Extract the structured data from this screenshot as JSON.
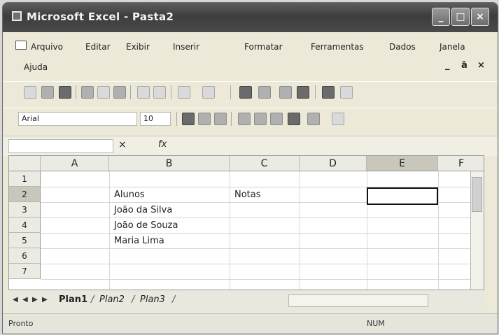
{
  "window": {
    "title": "Microsoft Excel - Pasta2",
    "min_glyph": "_",
    "max_glyph": "□",
    "close_glyph": "×"
  },
  "menu": {
    "items": [
      "Arquivo",
      "Editar",
      "Exibir",
      "Inserir",
      "Formatar",
      "Ferramentas",
      "Dados",
      "Janela"
    ],
    "help": "Ajuda",
    "doc_min": "_",
    "doc_restore": "ā",
    "doc_close": "×"
  },
  "format_toolbar": {
    "font": "Arial",
    "size": "10"
  },
  "formula_bar": {
    "fx": "fx",
    "cancel": "×"
  },
  "sheet": {
    "columns": [
      "A",
      "B",
      "C",
      "D",
      "E",
      "F"
    ],
    "rows": [
      "1",
      "2",
      "3",
      "4",
      "5",
      "6",
      "7"
    ],
    "cells": {
      "B2": "Alunos",
      "C2": "Notas",
      "B3": "João da Silva",
      "B4": "João de Souza",
      "B5": "Maria Lima"
    }
  },
  "tabs": {
    "sheets": [
      "Plan1",
      "Plan2",
      "Plan3"
    ]
  },
  "status": {
    "left": "Pronto",
    "right": "NUM"
  }
}
